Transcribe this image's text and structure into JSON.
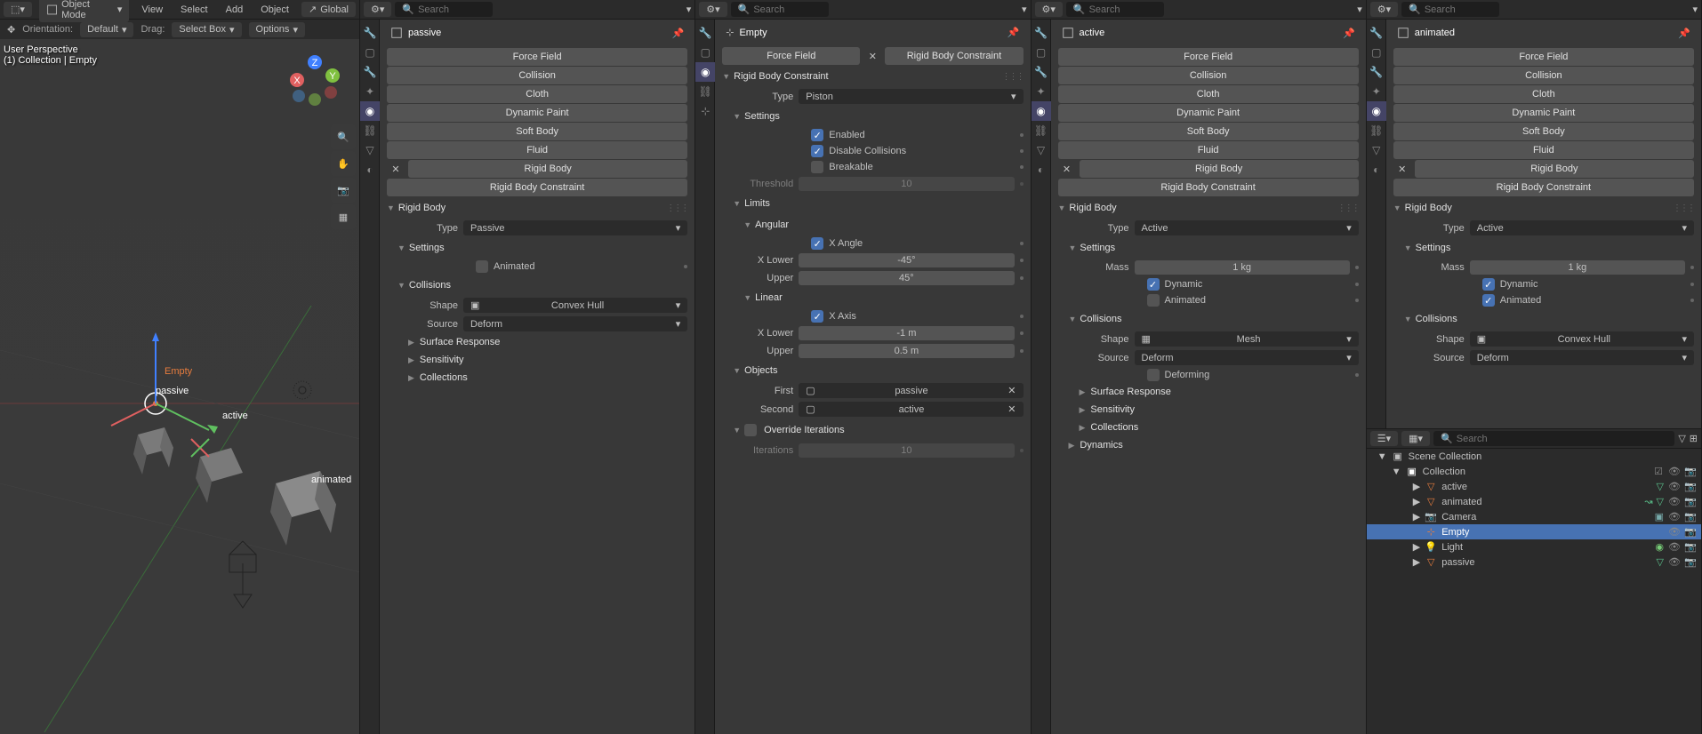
{
  "topbar": {
    "mode": "Object Mode",
    "menus": [
      "View",
      "Select",
      "Add",
      "Object"
    ],
    "global": "Global"
  },
  "orientation": {
    "label": "Orientation:",
    "value": "Default",
    "drag_label": "Drag:",
    "drag_value": "Select Box",
    "options": "Options"
  },
  "perspective": {
    "line1": "User Perspective",
    "line2": "(1) Collection | Empty"
  },
  "search_placeholder": "Search",
  "panels": [
    {
      "object": "passive",
      "rigid_body_type": "Passive",
      "settings": {
        "animated": false
      },
      "collisions": {
        "shape": "Convex Hull",
        "source": "Deform"
      },
      "subsections": [
        "Surface Response",
        "Sensitivity",
        "Collections"
      ]
    },
    {
      "object": "Empty",
      "constraint": {
        "title": "Rigid Body Constraint",
        "type": "Piston",
        "enabled": true,
        "disable_collisions": true,
        "breakable": false,
        "threshold": "10",
        "angular": {
          "x_angle": true,
          "x_lower": "-45°",
          "upper": "45°"
        },
        "linear": {
          "x_axis": true,
          "x_lower": "-1 m",
          "upper": "0.5 m"
        },
        "objects": {
          "first": "passive",
          "second": "active"
        },
        "iterations": "10"
      }
    },
    {
      "object": "active",
      "rigid_body_type": "Active",
      "mass": "1 kg",
      "dynamic": true,
      "animated": false,
      "collisions": {
        "shape": "Mesh",
        "source": "Deform",
        "deforming": false
      },
      "subsections": [
        "Surface Response",
        "Sensitivity",
        "Collections",
        "Dynamics"
      ]
    },
    {
      "object": "animated",
      "rigid_body_type": "Active",
      "mass": "1 kg",
      "dynamic": true,
      "animated": true,
      "collisions": {
        "shape": "Convex Hull",
        "source": "Deform"
      }
    }
  ],
  "physics_buttons": [
    "Force Field",
    "Collision",
    "Cloth",
    "Dynamic Paint",
    "Soft Body",
    "Fluid",
    "Rigid Body",
    "Rigid Body Constraint"
  ],
  "section_labels": {
    "rigid_body": "Rigid Body",
    "type": "Type",
    "settings": "Settings",
    "animated": "Animated",
    "collisions": "Collisions",
    "shape": "Shape",
    "source": "Source",
    "mass": "Mass",
    "dynamic": "Dynamic",
    "deforming": "Deforming",
    "rigid_body_constraint": "Rigid Body Constraint",
    "enabled": "Enabled",
    "disable_collisions": "Disable Collisions",
    "breakable": "Breakable",
    "threshold": "Threshold",
    "limits": "Limits",
    "angular": "Angular",
    "x_angle": "X Angle",
    "x_lower": "X Lower",
    "upper": "Upper",
    "linear": "Linear",
    "x_axis": "X Axis",
    "objects": "Objects",
    "first": "First",
    "second": "Second",
    "override_iterations": "Override Iterations",
    "iterations": "Iterations"
  },
  "outliner": {
    "root": "Scene Collection",
    "collection": "Collection",
    "items": [
      {
        "name": "active",
        "icon": "mesh",
        "color": "#e87d3e"
      },
      {
        "name": "animated",
        "icon": "mesh",
        "color": "#e87d3e"
      },
      {
        "name": "Camera",
        "icon": "camera",
        "color": "#e87d3e"
      },
      {
        "name": "Empty",
        "icon": "empty",
        "color": "#e87d3e",
        "selected": true
      },
      {
        "name": "Light",
        "icon": "light",
        "color": "#e87d3e"
      },
      {
        "name": "passive",
        "icon": "mesh",
        "color": "#e87d3e"
      }
    ]
  },
  "viewport_objects": [
    "Empty",
    "passive",
    "active",
    "animated"
  ]
}
